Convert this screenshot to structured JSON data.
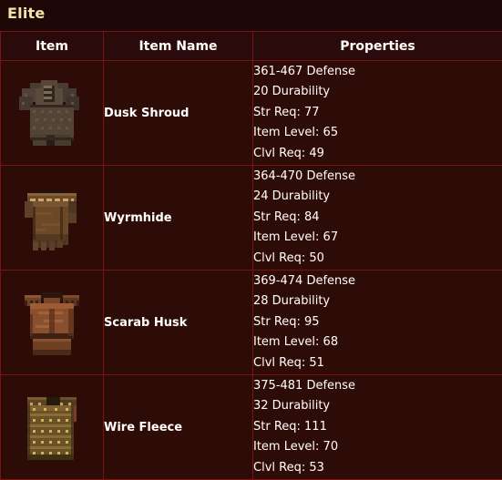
{
  "page": {
    "title": "Elite",
    "background_color": "#1d0707",
    "title_color": "#f5e3a8",
    "border_color": "#7a1414",
    "cell_background": "#2d0c08",
    "header_background": "#2a0a0a",
    "text_color": "#ffffff"
  },
  "table": {
    "columns": [
      {
        "key": "item",
        "label": "Item"
      },
      {
        "key": "name",
        "label": "Item Name"
      },
      {
        "key": "props",
        "label": "Properties"
      }
    ],
    "rows": [
      {
        "icon": "quilted-armor-icon",
        "name": "Dusk Shroud",
        "properties": [
          "361-467 Defense",
          "20 Durability",
          "Str Req: 77",
          "Item Level: 65",
          "Clvl Req: 49"
        ]
      },
      {
        "icon": "leather-armor-icon",
        "name": "Wyrmhide",
        "properties": [
          "364-470 Defense",
          "24 Durability",
          "Str Req: 84",
          "Item Level: 67",
          "Clvl Req: 50"
        ]
      },
      {
        "icon": "breastplate-armor-icon",
        "name": "Scarab Husk",
        "properties": [
          "369-474 Defense",
          "28 Durability",
          "Str Req: 95",
          "Item Level: 68",
          "Clvl Req: 51"
        ]
      },
      {
        "icon": "studded-cuirass-icon",
        "name": "Wire Fleece",
        "properties": [
          "375-481 Defense",
          "32 Durability",
          "Str Req: 111",
          "Item Level: 70",
          "Clvl Req: 53"
        ]
      }
    ]
  }
}
